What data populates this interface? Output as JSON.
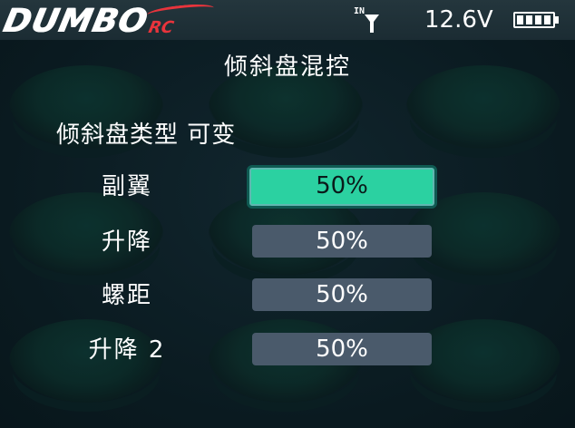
{
  "header": {
    "logo_text": "DUMBO",
    "logo_suffix": "RC",
    "signal_label": "IN",
    "voltage": "12.6V",
    "battery_level": 1.0
  },
  "page": {
    "title": "倾斜盘混控"
  },
  "swash_type": {
    "label": "倾斜盘类型",
    "value": "可变"
  },
  "rows": [
    {
      "label": "副翼",
      "value": "50%",
      "selected": true
    },
    {
      "label": "升降",
      "value": "50%",
      "selected": false
    },
    {
      "label": "螺距",
      "value": "50%",
      "selected": false
    },
    {
      "label": "升降 2",
      "value": "50%",
      "selected": false
    }
  ],
  "colors": {
    "selected_fill": "#2bd1a1",
    "field_fill": "#4a5a6b",
    "accent_red": "#e8343c"
  }
}
